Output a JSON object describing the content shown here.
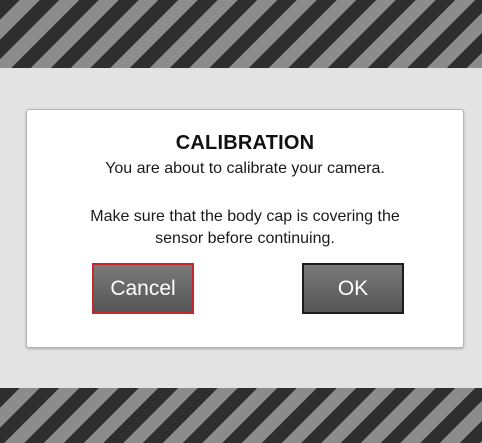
{
  "dialog": {
    "title": "CALIBRATION",
    "message_line1": "You are about to calibrate your camera.",
    "message_line2a": "Make sure that the body cap is covering the",
    "message_line2b": "sensor before continuing.",
    "cancel_label": "Cancel",
    "ok_label": "OK"
  },
  "colors": {
    "stripe_dark": "#2e2e2e",
    "stripe_light": "#8c8c8c",
    "cancel_border": "#c4282c",
    "button_fill": "#666666"
  }
}
